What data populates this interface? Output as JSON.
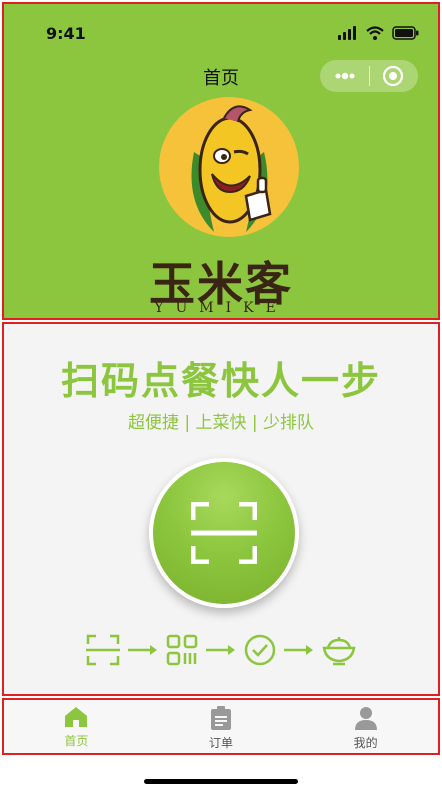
{
  "status_bar": {
    "time": "9:41"
  },
  "nav": {
    "title": "首页"
  },
  "brand": {
    "name_cn": "玉米客",
    "name_en": "YUMIKE"
  },
  "main": {
    "headline": "扫码点餐快人一步",
    "subline": "超便捷 | 上菜快 | 少排队"
  },
  "flow_icons": [
    "scan-icon",
    "qrcode-icon",
    "check-circle-icon",
    "rice-bowl-icon"
  ],
  "tabbar": {
    "items": [
      {
        "label": "首页",
        "icon": "home-icon",
        "active": true
      },
      {
        "label": "订单",
        "icon": "clipboard-icon",
        "active": false
      },
      {
        "label": "我的",
        "icon": "user-icon",
        "active": false
      }
    ]
  },
  "colors": {
    "brand_green": "#8cc63e",
    "brown": "#3a2414",
    "frame_red": "#e02020"
  }
}
